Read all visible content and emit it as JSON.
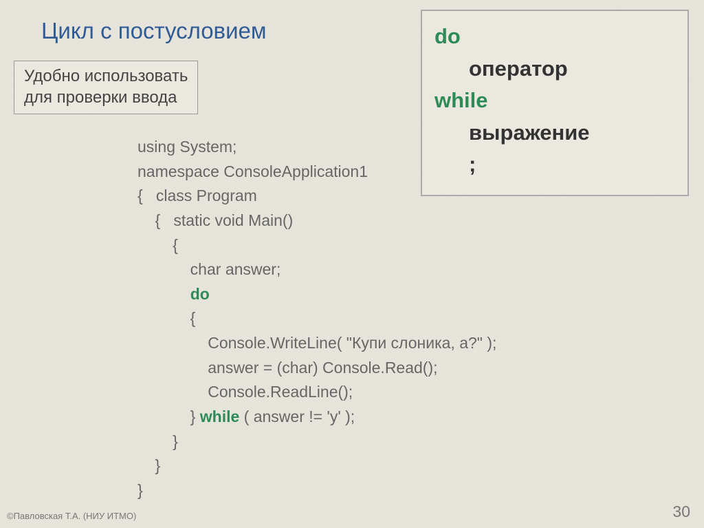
{
  "title": "Цикл с постусловием",
  "info_box": {
    "line1": "Удобно использовать",
    "line2": "для проверки ввода"
  },
  "syntax": {
    "do": "do",
    "operator": "оператор",
    "while": "while",
    "expression": "выражение",
    "semicolon": ";"
  },
  "code": {
    "l1": "using System;",
    "l2": "namespace ConsoleApplication1",
    "l3": "{   class Program",
    "l4": "    {   static void Main()",
    "l5": "        {",
    "l6": "            char answer;",
    "l7a": "            ",
    "l7b": "do",
    "l8": "            {",
    "l9": "                Console.WriteLine( \"Купи слоника, а?\" );",
    "l10": "                answer = (char) Console.Read();",
    "l11": "                Console.ReadLine();",
    "l12a": "            } ",
    "l12b": "while",
    "l12c": " ( answer != 'y' );",
    "l13": "        }",
    "l14": "    }",
    "l15": "}"
  },
  "footer": {
    "copyright": "©Павловская Т.А. (НИУ ИТМО)",
    "page": "30"
  }
}
